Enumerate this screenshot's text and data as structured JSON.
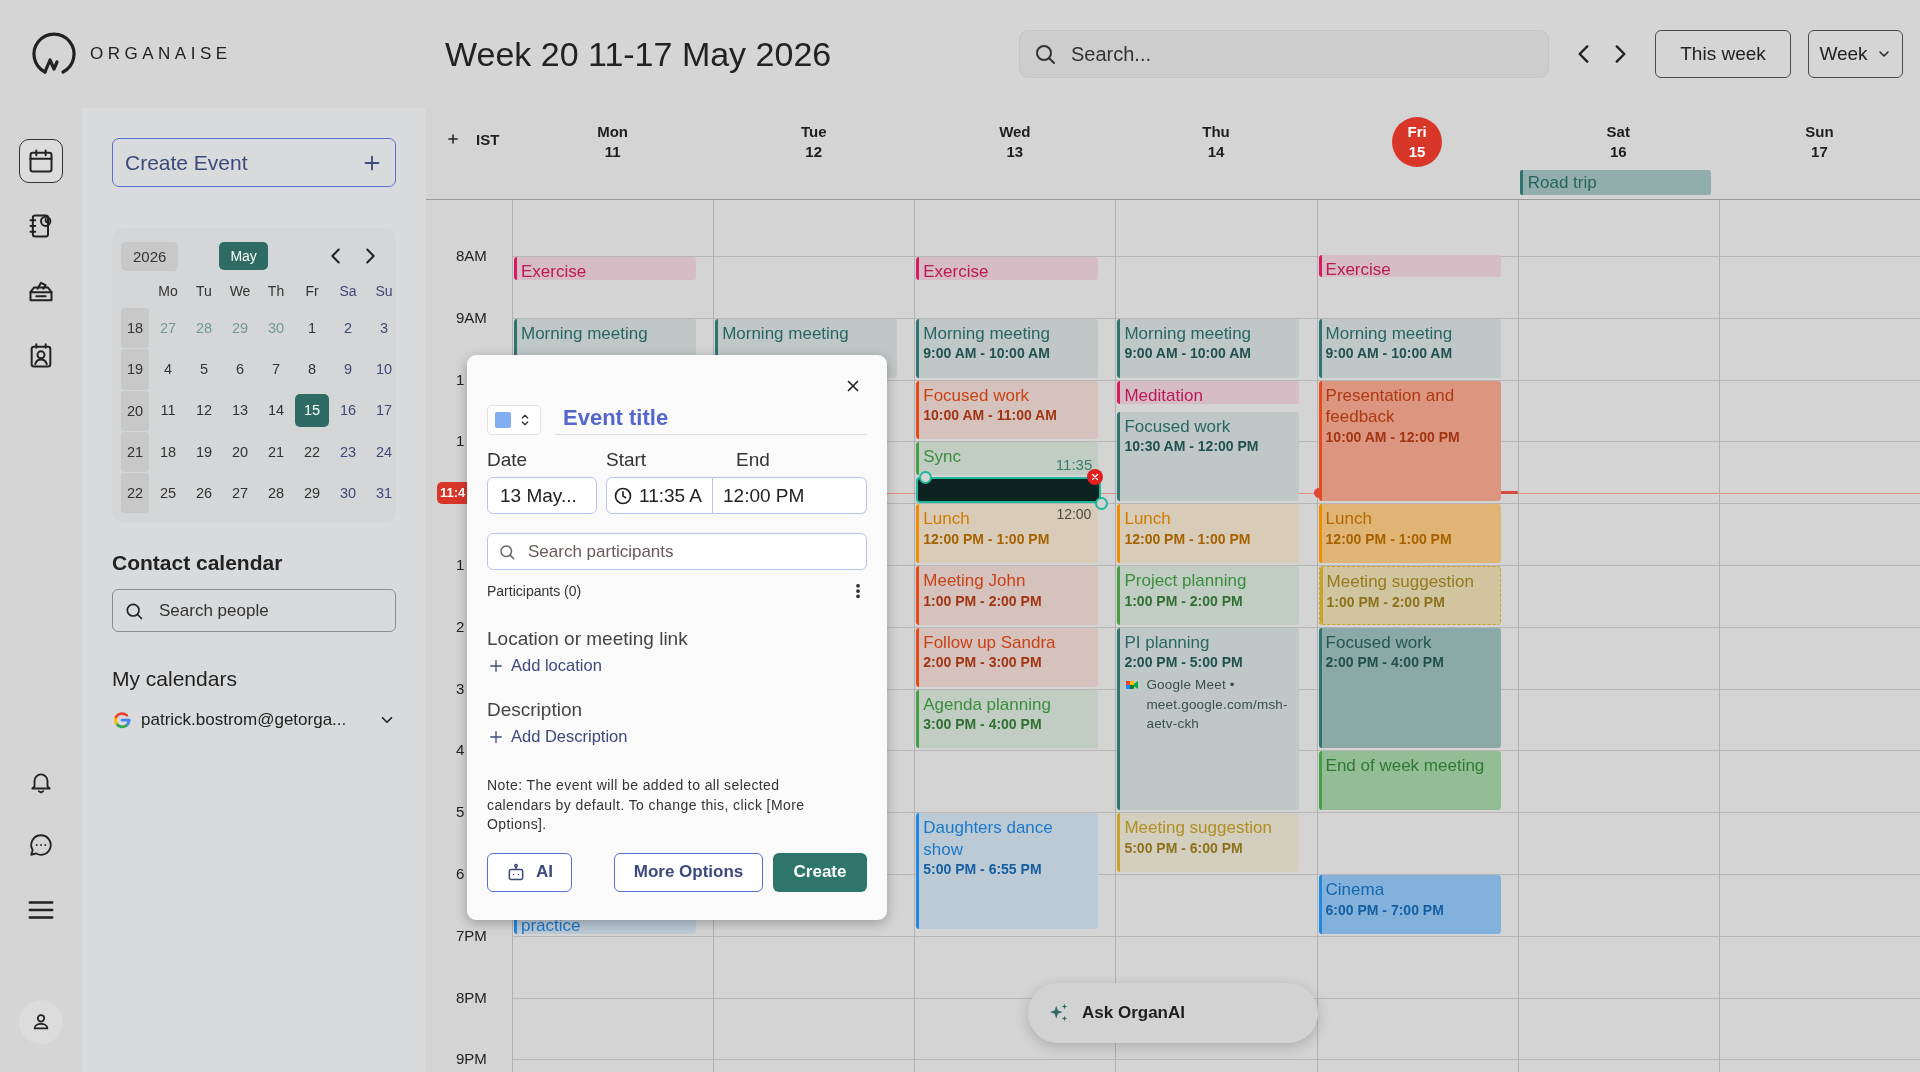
{
  "brand": {
    "name": "ORGANAISE"
  },
  "header": {
    "title": "Week 20 11-17 May 2026",
    "search": {
      "placeholder": "Search..."
    },
    "today_button": "This week",
    "view": "Week"
  },
  "rail": {
    "items": [
      {
        "selected": true
      },
      {
        "selected": false
      },
      {
        "selected": false
      },
      {
        "selected": false
      }
    ]
  },
  "sidebar": {
    "create_button": "Create Event",
    "mini_calendar": {
      "year": "2026",
      "month": "May",
      "weekdays": [
        {
          "label": "Mo",
          "weekend": false
        },
        {
          "label": "Tu",
          "weekend": false
        },
        {
          "label": "We",
          "weekend": false
        },
        {
          "label": "Th",
          "weekend": false
        },
        {
          "label": "Fr",
          "weekend": false
        },
        {
          "label": "Sa",
          "weekend": true
        },
        {
          "label": "Su",
          "weekend": true
        }
      ],
      "weeks": [
        {
          "number": "18",
          "days": [
            {
              "label": "27",
              "kind": "outside",
              "selected": false
            },
            {
              "label": "28",
              "kind": "outside",
              "selected": false
            },
            {
              "label": "29",
              "kind": "outside",
              "selected": false
            },
            {
              "label": "30",
              "kind": "outside",
              "selected": false
            },
            {
              "label": "1",
              "kind": "weekday",
              "selected": false
            },
            {
              "label": "2",
              "kind": "weekend",
              "selected": false
            },
            {
              "label": "3",
              "kind": "weekend",
              "selected": false
            }
          ]
        },
        {
          "number": "19",
          "days": [
            {
              "label": "4",
              "kind": "weekday",
              "selected": false
            },
            {
              "label": "5",
              "kind": "weekday",
              "selected": false
            },
            {
              "label": "6",
              "kind": "weekday",
              "selected": false
            },
            {
              "label": "7",
              "kind": "weekday",
              "selected": false
            },
            {
              "label": "8",
              "kind": "weekday",
              "selected": false
            },
            {
              "label": "9",
              "kind": "weekend",
              "selected": false
            },
            {
              "label": "10",
              "kind": "weekend",
              "selected": false
            }
          ]
        },
        {
          "number": "20",
          "days": [
            {
              "label": "11",
              "kind": "weekday",
              "selected": false
            },
            {
              "label": "12",
              "kind": "weekday",
              "selected": false
            },
            {
              "label": "13",
              "kind": "weekday",
              "selected": false
            },
            {
              "label": "14",
              "kind": "weekday",
              "selected": false
            },
            {
              "label": "15",
              "kind": "weekday",
              "selected": true
            },
            {
              "label": "16",
              "kind": "weekend",
              "selected": false
            },
            {
              "label": "17",
              "kind": "weekend",
              "selected": false
            }
          ]
        },
        {
          "number": "21",
          "days": [
            {
              "label": "18",
              "kind": "weekday",
              "selected": false
            },
            {
              "label": "19",
              "kind": "weekday",
              "selected": false
            },
            {
              "label": "20",
              "kind": "weekday",
              "selected": false
            },
            {
              "label": "21",
              "kind": "weekday",
              "selected": false
            },
            {
              "label": "22",
              "kind": "weekday",
              "selected": false
            },
            {
              "label": "23",
              "kind": "weekend",
              "selected": false
            },
            {
              "label": "24",
              "kind": "weekend",
              "selected": false
            }
          ]
        },
        {
          "number": "22",
          "days": [
            {
              "label": "25",
              "kind": "weekday",
              "selected": false
            },
            {
              "label": "26",
              "kind": "weekday",
              "selected": false
            },
            {
              "label": "27",
              "kind": "weekday",
              "selected": false
            },
            {
              "label": "28",
              "kind": "weekday",
              "selected": false
            },
            {
              "label": "29",
              "kind": "weekday",
              "selected": false
            },
            {
              "label": "30",
              "kind": "weekend",
              "selected": false
            },
            {
              "label": "31",
              "kind": "weekend",
              "selected": false
            }
          ]
        }
      ]
    },
    "contact": {
      "heading": "Contact calendar",
      "search": {
        "placeholder": "Search people"
      }
    },
    "calendars": {
      "heading": "My calendars",
      "account": "patrick.bostrom@getorga..."
    }
  },
  "calendar": {
    "timezone": "IST",
    "hours": [
      "8AM",
      "9AM",
      "1",
      "1",
      "1",
      "2",
      "3",
      "4",
      "5",
      "6",
      "7PM",
      "8PM",
      "9PM"
    ],
    "now": {
      "badge": "11:4"
    },
    "days": [
      {
        "name": "Mon",
        "date": "11",
        "today": false,
        "events": [
          {
            "title": "Exercise",
            "color": "#d81b60",
            "kind": "soft"
          },
          {
            "title": "Morning meeting",
            "color": "#2f7470",
            "kind": "soft"
          },
          {
            "title": "practice",
            "color": "#1e88e5",
            "kind": "soft"
          }
        ]
      },
      {
        "name": "Tue",
        "date": "12",
        "today": false,
        "events": [
          {
            "title": "Morning meeting",
            "color": "#2f7470",
            "kind": "soft"
          }
        ]
      },
      {
        "name": "Wed",
        "date": "13",
        "today": false,
        "events": [
          {
            "title": "Exercise",
            "color": "#d81b60",
            "kind": "soft"
          },
          {
            "title": "Morning meeting",
            "time": "9:00 AM - 10:00 AM",
            "color": "#2f7470",
            "kind": "soft"
          },
          {
            "title": "Focused work",
            "time": "10:00 AM - 11:00 AM",
            "color": "#e64a19",
            "kind": "soft"
          },
          {
            "title": "Sync",
            "color": "#43a047",
            "kind": "soft"
          },
          {
            "title": "Lunch",
            "time": "12:00 PM - 1:00 PM",
            "color": "#ef8c00",
            "kind": "soft"
          },
          {
            "title": "Meeting John",
            "time": "1:00 PM - 2:00 PM",
            "color": "#e64a19",
            "kind": "soft"
          },
          {
            "title": "Follow up Sandra",
            "time": "2:00 PM - 3:00 PM",
            "color": "#e64a19",
            "kind": "soft"
          },
          {
            "title": "Agenda planning",
            "time": "3:00 PM - 4:00 PM",
            "color": "#43a047",
            "kind": "soft"
          },
          {
            "title": "Daughters dance show",
            "time": "5:00 PM - 6:55 PM",
            "color": "#1e88e5",
            "kind": "soft"
          }
        ],
        "draft": {
          "start_label": "11:35",
          "end_label": "12:00"
        }
      },
      {
        "name": "Thu",
        "date": "14",
        "today": false,
        "events": [
          {
            "title": "Morning meeting",
            "time": "9:00 AM - 10:00 AM",
            "color": "#2f7470",
            "kind": "soft"
          },
          {
            "title": "Meditation",
            "color": "#d81b60",
            "kind": "soft"
          },
          {
            "title": "Focused work",
            "time": "10:30 AM - 12:00 PM",
            "color": "#2f7470",
            "kind": "soft"
          },
          {
            "title": "Lunch",
            "time": "12:00 PM - 1:00 PM",
            "color": "#ef8c00",
            "kind": "soft"
          },
          {
            "title": "Project planning",
            "time": "1:00 PM - 2:00 PM",
            "color": "#43a047",
            "kind": "soft"
          },
          {
            "title": "PI planning",
            "time": "2:00 PM - 5:00 PM",
            "meeting": "Google Meet • meet.google.com/msh-aetv-ckh",
            "color": "#2f7470",
            "kind": "soft"
          },
          {
            "title": "Meeting suggestion",
            "time": "5:00 PM - 6:00 PM",
            "color": "#c9a227",
            "kind": "soft"
          }
        ]
      },
      {
        "name": "Fri",
        "date": "15",
        "today": true,
        "events": [
          {
            "title": "Exercise",
            "color": "#d81b60",
            "kind": "soft"
          },
          {
            "title": "Morning meeting",
            "time": "9:00 AM - 10:00 AM",
            "color": "#2f7470",
            "kind": "soft"
          },
          {
            "title": "Presentation and feedback",
            "time": "10:00 AM - 12:00 PM",
            "color": "#e64a19",
            "kind": "bold"
          },
          {
            "title": "Lunch",
            "time": "12:00 PM - 1:00 PM",
            "color": "#ef8c00",
            "kind": "bold"
          },
          {
            "title": "Meeting suggestion",
            "time": "1:00 PM - 2:00 PM",
            "color": "#c9a227",
            "kind": "dashed"
          },
          {
            "title": "Focused work",
            "time": "2:00 PM - 4:00 PM",
            "color": "#2f7470",
            "kind": "bold"
          },
          {
            "title": "End of week meeting",
            "color": "#43a047",
            "kind": "bold"
          },
          {
            "title": "Cinema",
            "time": "6:00 PM - 7:00 PM",
            "color": "#1e88e5",
            "kind": "bold"
          }
        ]
      },
      {
        "name": "Sat",
        "date": "16",
        "today": false,
        "all_day": [
          {
            "title": "Road trip",
            "color": "#2f7470"
          }
        ]
      },
      {
        "name": "Sun",
        "date": "17",
        "today": false
      }
    ]
  },
  "dialog": {
    "color": "#82aef5",
    "title": {
      "placeholder": "Event title"
    },
    "date": {
      "label": "Date",
      "value": "13 May..."
    },
    "start": {
      "label": "Start",
      "value": "11:35 A"
    },
    "end": {
      "label": "End",
      "value": "12:00 PM"
    },
    "participants": {
      "placeholder": "Search participants",
      "count": "Participants (0)"
    },
    "location": {
      "heading": "Location or meeting link",
      "link": "Add location"
    },
    "description": {
      "heading": "Description",
      "link": "Add Description"
    },
    "note": "Note: The event will be added to all selected calendars by default. To change this, click [More Options].",
    "buttons": {
      "ai": "AI",
      "more": "More Options",
      "create": "Create"
    }
  },
  "assistant": {
    "label": "Ask OrganAI"
  }
}
